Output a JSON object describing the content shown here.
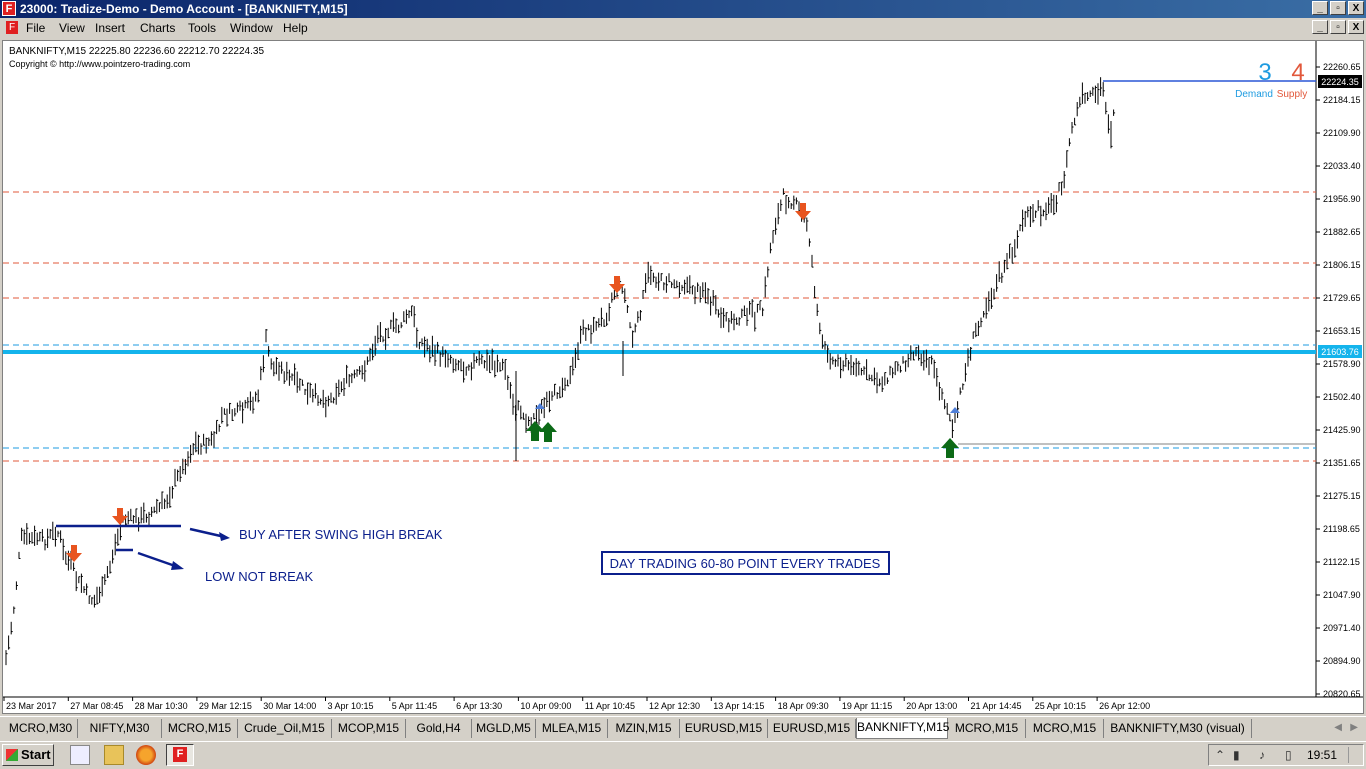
{
  "window": {
    "title": "23000: Tradize-Demo - Demo Account - [BANKNIFTY,M15]",
    "app_icon": "F",
    "buttons": [
      "_",
      "▫",
      "X"
    ]
  },
  "menu": {
    "items": [
      "File",
      "View",
      "Insert",
      "Charts",
      "Tools",
      "Window",
      "Help"
    ]
  },
  "chart": {
    "info_line": "BANKNIFTY,M15  22225.80 22236.60 22212.70 22224.35",
    "copyright": "Copyright © http://www.pointzero-trading.com",
    "demand_count": "3",
    "supply_count": "4",
    "demand_label": "Demand",
    "supply_label": "Supply",
    "current_price": "22224.35",
    "level_price": "21603.76",
    "price_labels": [
      "22260.65",
      "22184.15",
      "22109.90",
      "22033.40",
      "21956.90",
      "21882.65",
      "21806.15",
      "21729.65",
      "21653.15",
      "21578.90",
      "21502.40",
      "21425.90",
      "21351.65",
      "21275.15",
      "21198.65",
      "21122.15",
      "21047.90",
      "20971.40",
      "20894.90",
      "20820.65"
    ],
    "time_labels": [
      "23 Mar 2017",
      "27 Mar 08:45",
      "28 Mar 10:30",
      "29 Mar 12:15",
      "30 Mar 14:00",
      "3 Apr 10:15",
      "5 Apr 11:45",
      "6 Apr 13:30",
      "10 Apr 09:00",
      "11 Apr 10:45",
      "12 Apr 12:30",
      "13 Apr 14:15",
      "18 Apr 09:30",
      "19 Apr 11:15",
      "20 Apr 13:00",
      "21 Apr 14:45",
      "25 Apr 10:15",
      "26 Apr 12:00"
    ],
    "annotation_buy": "BUY AFTER SWING HIGH BREAK",
    "annotation_low": "LOW NOT BREAK",
    "annotation_box": "DAY TRADING 60-80 POINT EVERY TRADES",
    "colors": {
      "demand": "#1e9be0",
      "supply": "#e2583b",
      "level_line": "#14b4ec",
      "current_line": "#2a56d6",
      "annotation": "#0b1f8c",
      "up_arrow": "#0c6a17",
      "down_arrow": "#e8541f"
    }
  },
  "tabs": [
    "MCRO,M30",
    "NIFTY,M30",
    "MCRO,M15",
    "Crude_Oil,M15",
    "MCOP,M15",
    "Gold,H4",
    "MGLD,M5",
    "MLEA,M15",
    "MZIN,M15",
    "EURUSD,M15",
    "EURUSD,M15",
    "BANKNIFTY,M15",
    "MCRO,M15",
    "MCRO,M15",
    "BANKNIFTY,M30 (visual)"
  ],
  "active_tab": "BANKNIFTY,M15",
  "taskbar": {
    "start_label": "Start",
    "clock": "19:51"
  }
}
